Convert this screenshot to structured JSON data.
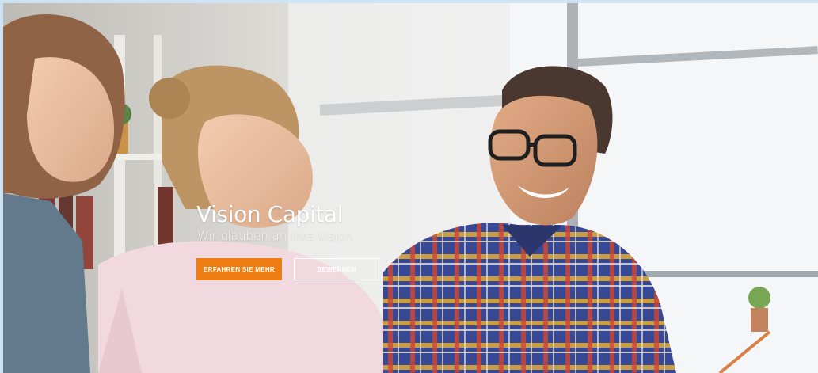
{
  "hero": {
    "title": "Vision Capital",
    "subtitle": "Wir glauben an Ihre Vision.",
    "primary_button": "ERFAHREN SIE MEHR",
    "secondary_button": "BEWERBEN"
  },
  "colors": {
    "accent": "#ee7d13",
    "frame_border": "#cfe3f3"
  }
}
